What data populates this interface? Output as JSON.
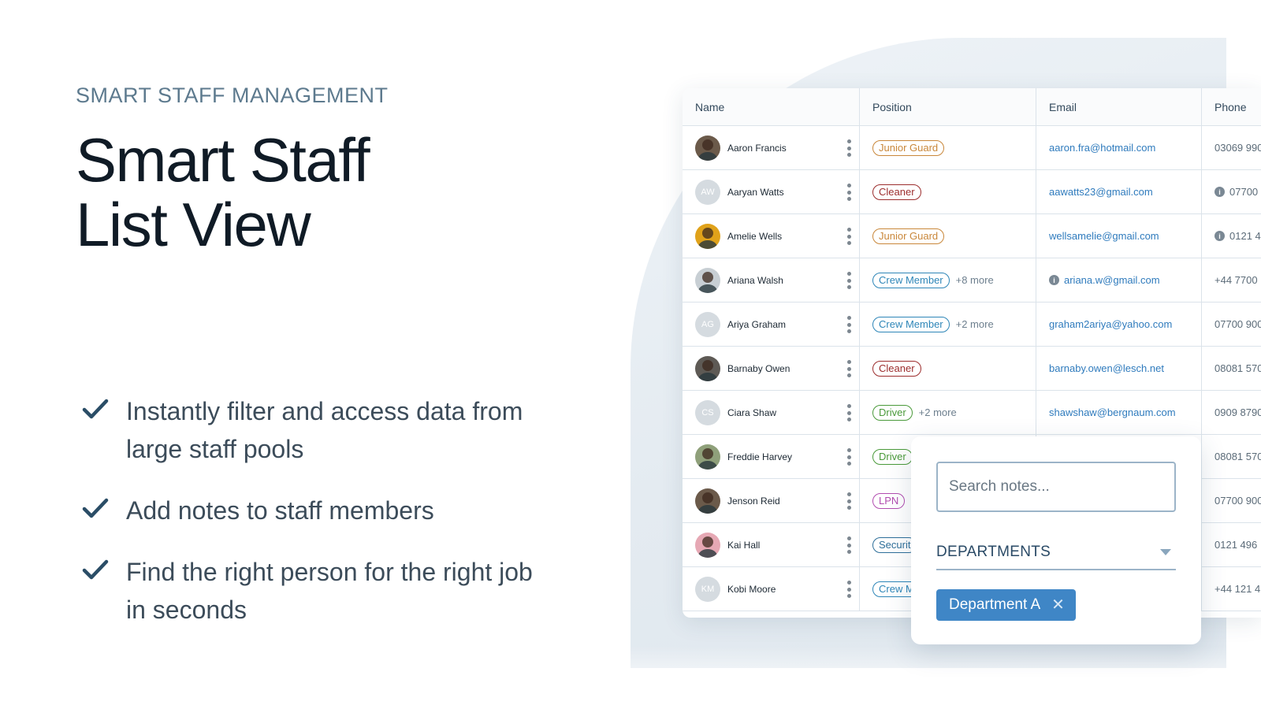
{
  "hero": {
    "eyebrow": "SMART STAFF MANAGEMENT",
    "title_line1": "Smart Staff",
    "title_line2": "List View",
    "features": [
      "Instantly filter and access data from large staff pools",
      "Add notes to staff members",
      "Find the right person for the right job in seconds"
    ],
    "icons": {
      "feature_check": "check-icon"
    }
  },
  "colors": {
    "headline": "#101b26",
    "eyebrow": "#5d7a8e",
    "check": "#2a4d66",
    "link": "#2f7bbd",
    "chip": "#3f86c6"
  },
  "table": {
    "headers": {
      "name": "Name",
      "position": "Position",
      "email": "Email",
      "phone": "Phone"
    },
    "rows": [
      {
        "name": "Aaron Francis",
        "initials": "",
        "photo": true,
        "avatar_color": "#6b5a4a",
        "position": "Junior Guard",
        "position_color": "#c9873a",
        "more": "",
        "email": "aaron.fra@hotmail.com",
        "email_info": false,
        "phone": "03069 990",
        "phone_info": false
      },
      {
        "name": "Aaryan Watts",
        "initials": "AW",
        "photo": false,
        "avatar_color": "#d5dbe0",
        "position": "Cleaner",
        "position_color": "#9c2d2d",
        "more": "",
        "email": "aawatts23@gmail.com",
        "email_info": false,
        "phone": "07700 ",
        "phone_info": true
      },
      {
        "name": "Amelie Wells",
        "initials": "",
        "photo": true,
        "avatar_color": "#e0a21a",
        "position": "Junior Guard",
        "position_color": "#c9873a",
        "more": "",
        "email": "wellsamelie@gmail.com",
        "email_info": false,
        "phone": "0121 4",
        "phone_info": true
      },
      {
        "name": "Ariana Walsh",
        "initials": "",
        "photo": true,
        "avatar_color": "#c8cfd4",
        "position": "Crew Member",
        "position_color": "#2e86b8",
        "more": "+8 more",
        "email": "ariana.w@gmail.com",
        "email_info": true,
        "phone": "+44 7700",
        "phone_info": false
      },
      {
        "name": "Ariya Graham",
        "initials": "AG",
        "photo": false,
        "avatar_color": "#d5dbe0",
        "position": "Crew Member",
        "position_color": "#2e86b8",
        "more": "+2 more",
        "email": "graham2ariya@yahoo.com",
        "email_info": false,
        "phone": "07700 900",
        "phone_info": false
      },
      {
        "name": "Barnaby Owen",
        "initials": "",
        "photo": true,
        "avatar_color": "#5e5a55",
        "position": "Cleaner",
        "position_color": "#9c2d2d",
        "more": "",
        "email": "barnaby.owen@lesch.net",
        "email_info": false,
        "phone": "08081 570",
        "phone_info": false
      },
      {
        "name": "Ciara Shaw",
        "initials": "CS",
        "photo": false,
        "avatar_color": "#d5dbe0",
        "position": "Driver",
        "position_color": "#4a9a3a",
        "more": "+2 more",
        "email": "shawshaw@bergnaum.com",
        "email_info": false,
        "phone": "0909 8790",
        "phone_info": false
      },
      {
        "name": "Freddie Harvey",
        "initials": "",
        "photo": true,
        "avatar_color": "#8fa07a",
        "position": "Driver",
        "position_color": "#4a9a3a",
        "more": "",
        "email": "",
        "email_info": false,
        "phone": "08081 570",
        "phone_info": false
      },
      {
        "name": "Jenson Reid",
        "initials": "",
        "photo": true,
        "avatar_color": "#6b5a4a",
        "position": "LPN",
        "position_color": "#b24db0",
        "more": "",
        "email": "",
        "email_info": false,
        "phone": "07700 900",
        "phone_info": false
      },
      {
        "name": "Kai Hall",
        "initials": "",
        "photo": true,
        "avatar_color": "#e6a8b4",
        "position": "Securit",
        "position_color": "#2e6f9a",
        "more": "",
        "email": "",
        "email_info": false,
        "phone": "0121 496",
        "phone_info": false
      },
      {
        "name": "Kobi Moore",
        "initials": "KM",
        "photo": false,
        "avatar_color": "#d5dbe0",
        "position": "Crew M",
        "position_color": "#2e86b8",
        "more": "",
        "email": "",
        "email_info": false,
        "phone": "+44 121 4",
        "phone_info": false
      }
    ]
  },
  "notes_popover": {
    "search_placeholder": "Search notes...",
    "departments_label": "DEPARTMENTS",
    "selected_department": "Department A",
    "remove_symbol": "✕"
  }
}
